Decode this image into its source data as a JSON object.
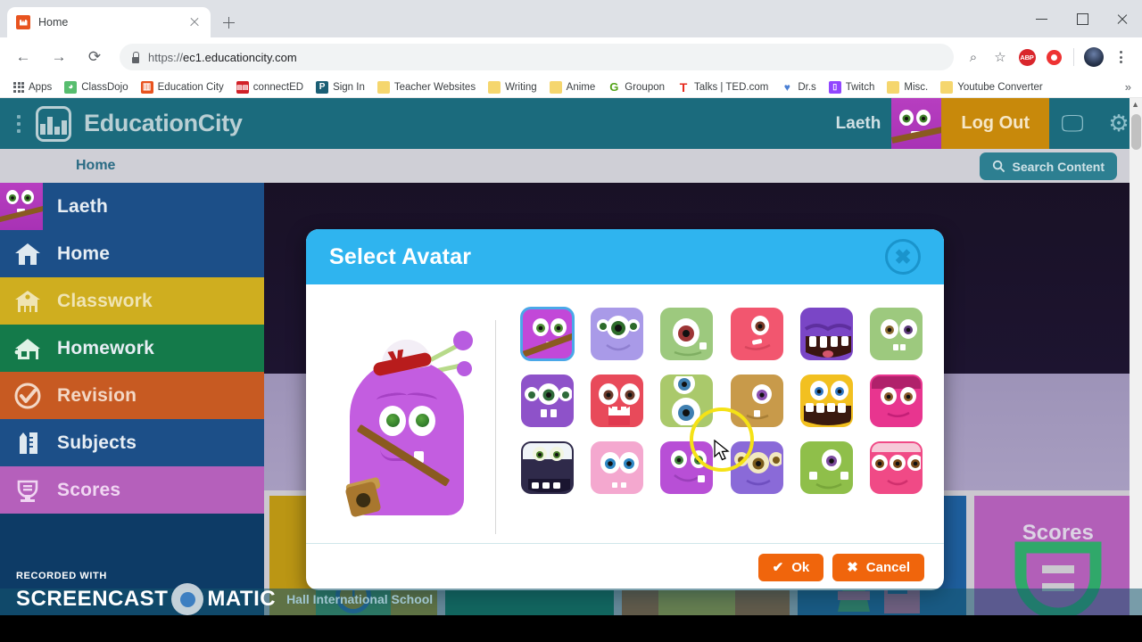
{
  "browser": {
    "tab": {
      "title": "Home",
      "favicon": "educationcity-favicon",
      "close": "×"
    },
    "newtab_label": "+",
    "window": {
      "minimize": "–",
      "maximize": "□",
      "close": "×"
    },
    "nav": {
      "back": "←",
      "forward": "→",
      "reload": "⟳"
    },
    "omnibox": {
      "lock": "lock-icon",
      "url_prefix": "https://",
      "url_domain": "ec1.educationcity.com",
      "full_url": "https://ec1.educationcity.com"
    },
    "toolbar_right": {
      "zoom": "⌕",
      "bookmark_star": "☆",
      "ext_abp": "ABP",
      "ext_record": "record-icon",
      "profile": "profile-avatar",
      "menu": "kebab-menu"
    },
    "bookmarks": [
      {
        "label": "Apps",
        "icon": "apps-grid-icon"
      },
      {
        "label": "ClassDojo",
        "icon": "classdojo-icon"
      },
      {
        "label": "Education City",
        "icon": "educationcity-icon"
      },
      {
        "label": "connectED",
        "icon": "connected-icon"
      },
      {
        "label": "Sign In",
        "icon": "signin-icon"
      },
      {
        "label": "Teacher Websites",
        "icon": "folder-icon"
      },
      {
        "label": "Writing",
        "icon": "folder-icon"
      },
      {
        "label": "Anime",
        "icon": "folder-icon"
      },
      {
        "label": "Groupon",
        "icon": "groupon-icon"
      },
      {
        "label": "Talks | TED.com",
        "icon": "ted-icon"
      },
      {
        "label": "Dr.s",
        "icon": "heart-icon"
      },
      {
        "label": "Twitch",
        "icon": "twitch-icon"
      },
      {
        "label": "Misc.",
        "icon": "folder-icon"
      },
      {
        "label": "Youtube Converter",
        "icon": "folder-icon"
      }
    ],
    "bookmarks_overflow": "»"
  },
  "site": {
    "brand": "EducationCity",
    "username": "Laeth",
    "logout_label": "Log Out",
    "subnav_home": "Home",
    "search_label": "Search Content",
    "header_icons": [
      "monitor-icon",
      "settings-gear-icon"
    ],
    "sidebar": [
      {
        "label": "Laeth",
        "icon": "user-avatar-icon",
        "theme": "laeth"
      },
      {
        "label": "Home",
        "icon": "house-icon",
        "theme": "home"
      },
      {
        "label": "Classwork",
        "icon": "school-icon",
        "theme": "classwork"
      },
      {
        "label": "Homework",
        "icon": "home-desk-icon",
        "theme": "homework"
      },
      {
        "label": "Revision",
        "icon": "check-circle-icon",
        "theme": "revision"
      },
      {
        "label": "Subjects",
        "icon": "ruler-pencil-icon",
        "theme": "subjects"
      },
      {
        "label": "Scores",
        "icon": "trophy-icon",
        "theme": "scores"
      }
    ],
    "tiles": [
      {
        "label": "",
        "theme": "classwork"
      },
      {
        "label": "",
        "theme": "homework"
      },
      {
        "label": "",
        "theme": "revision"
      },
      {
        "label": "",
        "theme": "subjects"
      },
      {
        "label": "Scores",
        "theme": "scores"
      }
    ]
  },
  "modal": {
    "title": "Select Avatar",
    "close_glyph": "✖",
    "preview_alt": "purple-monster-avatar-preview",
    "ok_label": "Ok",
    "ok_glyph": "✔",
    "cancel_label": "Cancel",
    "cancel_glyph": "✖",
    "avatars": [
      {
        "id": "avatar-1",
        "name": "purple-monster-sash",
        "bg": "#c248d8",
        "selected": true
      },
      {
        "id": "avatar-2",
        "name": "lavender-three-eyes",
        "bg": "#a99ae8",
        "selected": false
      },
      {
        "id": "avatar-3",
        "name": "green-cyclops",
        "bg": "#9dc97e",
        "selected": false
      },
      {
        "id": "avatar-4",
        "name": "pink-one-eye",
        "bg": "#f2566f",
        "selected": false
      },
      {
        "id": "avatar-5",
        "name": "purple-big-teeth",
        "bg": "#7a46c6",
        "selected": false
      },
      {
        "id": "avatar-6",
        "name": "green-two-eyes",
        "bg": "#9dc97e",
        "selected": false
      },
      {
        "id": "avatar-7",
        "name": "violet-three-eyes",
        "bg": "#8e52c9",
        "selected": false
      },
      {
        "id": "avatar-8",
        "name": "red-wide-eyes",
        "bg": "#e84a5a",
        "selected": false
      },
      {
        "id": "avatar-9",
        "name": "green-stacked-eyes",
        "bg": "#aac96b",
        "selected": false
      },
      {
        "id": "avatar-10",
        "name": "tan-single-eye",
        "bg": "#c89a4a",
        "selected": false
      },
      {
        "id": "avatar-11",
        "name": "yellow-toothy",
        "bg": "#f2c020",
        "selected": false
      },
      {
        "id": "avatar-12",
        "name": "magenta-monster",
        "bg": "#e8358f",
        "selected": false
      },
      {
        "id": "avatar-13",
        "name": "dark-navy-antenna",
        "bg": "#2f2a4a",
        "selected": false
      },
      {
        "id": "avatar-14",
        "name": "pink-blue-eyes",
        "bg": "#f4a8cf",
        "selected": false
      },
      {
        "id": "avatar-15",
        "name": "purple-smile",
        "bg": "#b84fd6",
        "selected": false
      },
      {
        "id": "avatar-16",
        "name": "violet-three-eyes-smile",
        "bg": "#8a6ad8",
        "selected": false
      },
      {
        "id": "avatar-17",
        "name": "green-one-eye-teeth",
        "bg": "#8fbf4a",
        "selected": false
      },
      {
        "id": "avatar-18",
        "name": "pink-three-eyes",
        "bg": "#f04a86",
        "selected": false
      }
    ]
  },
  "watermark": {
    "recorded_with": "RECORDED WITH",
    "brand_left": "SCREENCAST",
    "brand_right": "MATIC",
    "school": "Hall International School"
  },
  "colors": {
    "modal_header": "#2fb4ef",
    "button_orange": "#f0650c",
    "site_header": "#1b6b7d",
    "sidebar_blue": "#1c4f88",
    "highlight_ring": "#f5e216"
  }
}
